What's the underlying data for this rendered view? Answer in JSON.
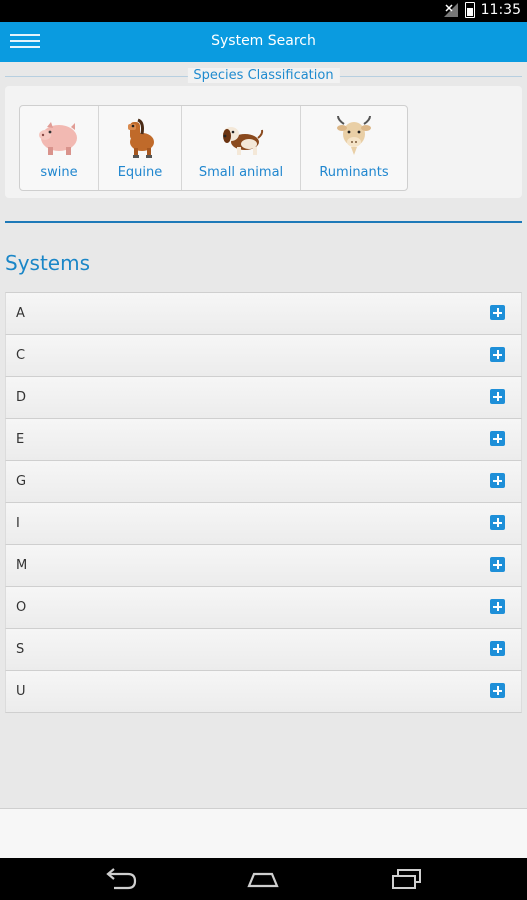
{
  "status": {
    "time": "11:35"
  },
  "header": {
    "title": "System Search"
  },
  "species": {
    "legend": "Species Classification",
    "items": [
      {
        "label": "swine",
        "icon": "pig-icon"
      },
      {
        "label": "Equine",
        "icon": "horse-icon"
      },
      {
        "label": "Small animal",
        "icon": "dog-icon"
      },
      {
        "label": "Ruminants",
        "icon": "cow-icon"
      }
    ]
  },
  "systems": {
    "title": "Systems",
    "rows": [
      "A",
      "C",
      "D",
      "E",
      "G",
      "I",
      "M",
      "O",
      "S",
      "U"
    ]
  },
  "colors": {
    "accent": "#0a9be0",
    "link": "#2187cf",
    "plus": "#1e8fd8"
  }
}
